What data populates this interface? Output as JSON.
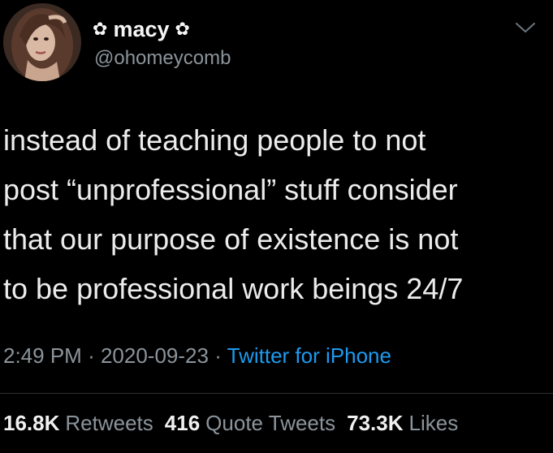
{
  "author": {
    "display_name": "macy",
    "decoration_icon": "flower-icon",
    "decoration_glyph": "✿",
    "handle": "@ohomeycomb"
  },
  "tweet": {
    "text": "instead of teaching people to not\npost “unprofessional” stuff consider\nthat our purpose of existence is not\nto be professional work beings 24/7",
    "time": "2:49 PM",
    "separator": "·",
    "date": "2020-09-23",
    "source": "Twitter for iPhone"
  },
  "stats": {
    "retweets": {
      "count": "16.8K",
      "label": "Retweets"
    },
    "quote_tweets": {
      "count": "416",
      "label": "Quote Tweets"
    },
    "likes": {
      "count": "73.3K",
      "label": "Likes"
    }
  },
  "colors": {
    "background": "#000000",
    "text": "#e7e9ea",
    "secondary": "#8b949b",
    "link": "#1d9bf0"
  }
}
